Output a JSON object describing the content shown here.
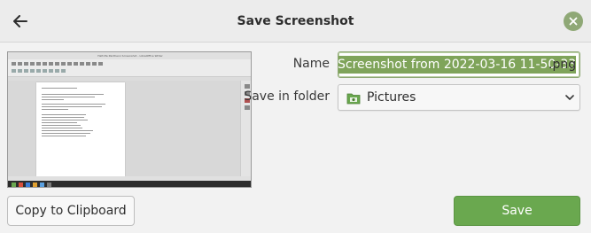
{
  "header": {
    "title": "Save Screenshot",
    "back_icon": "arrow-left-icon",
    "close_icon": "close-icon"
  },
  "preview": {
    "window_title": "Half-life Pantheon Screenshot - LibreOffice Writer"
  },
  "form": {
    "name_label": "Name",
    "name_value_selected": "Screenshot from 2022-03-16 11-50-33",
    "name_value_extension": ".png",
    "folder_label": "Save in folder",
    "folder_value": "Pictures",
    "folder_icon": "pictures-folder-icon"
  },
  "buttons": {
    "copy_label": "Copy to Clipboard",
    "save_label": "Save"
  },
  "colors": {
    "accent": "#6aa84f",
    "selection": "#7fa45a",
    "close_button": "#8fa876"
  }
}
